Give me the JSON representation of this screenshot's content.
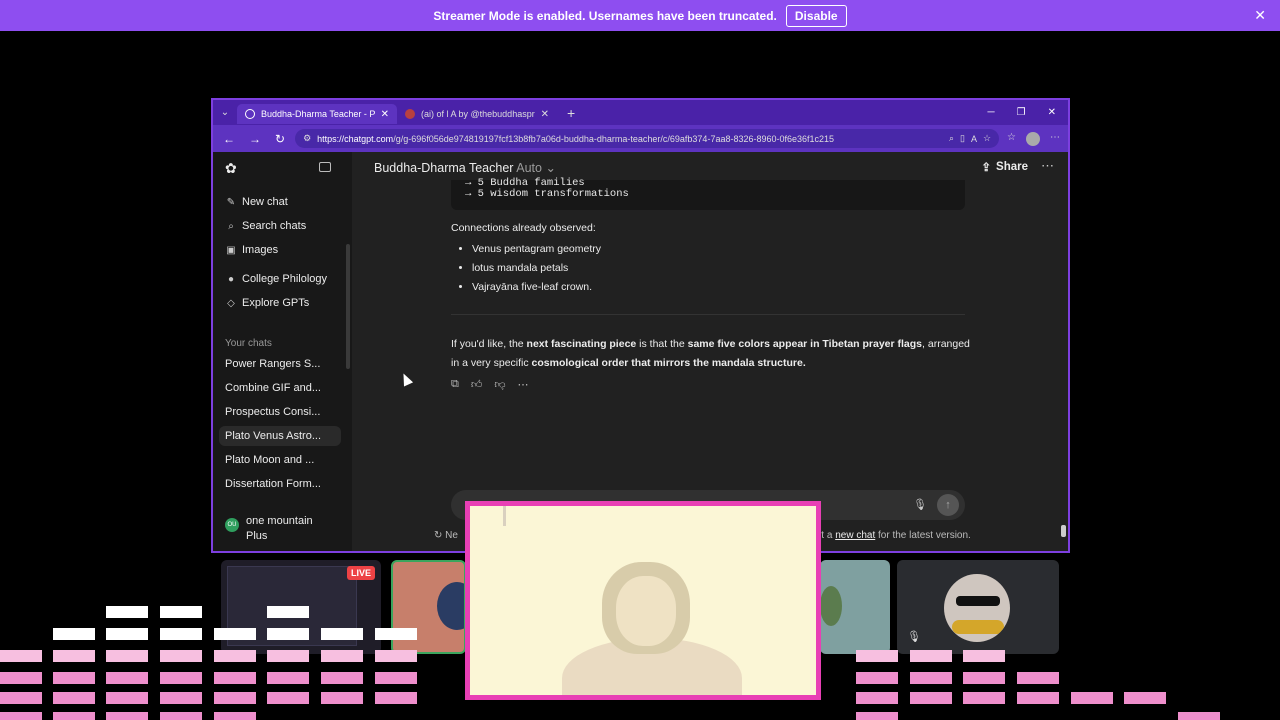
{
  "banner": {
    "message": "Streamer Mode is enabled. Usernames have been truncated.",
    "disable_label": "Disable",
    "close_icon": "✕"
  },
  "browser": {
    "tabs": [
      {
        "label": "Buddha-Dharma Teacher - Plato V",
        "active": true
      },
      {
        "label": "(ai) of l A by @thebuddhaspriest",
        "active": false
      }
    ],
    "new_tab": "+",
    "url_host": "https://chatgpt.com",
    "url_path": "/g/g-696f056de974819197fcf13b8fb7a06d-buddha-dharma-teacher/c/69afb374-7aa8-8326-8960-0f6e36f1c215"
  },
  "sidebar": {
    "top_items": [
      {
        "label": "New chat",
        "icon": "✎"
      },
      {
        "label": "Search chats",
        "icon": "⌕"
      },
      {
        "label": "Images",
        "icon": "▣"
      },
      {
        "label": "College Philology",
        "icon": "●"
      },
      {
        "label": "Explore GPTs",
        "icon": "◇"
      }
    ],
    "section": "Your chats",
    "chats": [
      "Power Rangers S...",
      "Combine GIF and...",
      "Prospectus Consi...",
      "Plato Venus Astro...",
      "Plato Moon and ...",
      "Dissertation Form..."
    ],
    "user": {
      "initials": "OU",
      "name_line1": "one mountain",
      "name_line2": "Plus"
    }
  },
  "chat": {
    "title": "Buddha-Dharma Teacher",
    "mode": "Auto",
    "share_label": "Share",
    "code_lines": [
      "→ 5 Buddha families",
      "→ 5 wisdom transformations"
    ],
    "connections_heading": "Connections already observed:",
    "bullets": [
      "Venus pentagram geometry",
      "lotus mandala petals",
      "Vajrayāna five-leaf crown."
    ],
    "closing_parts": [
      {
        "t": "If you'd like, the ",
        "b": false
      },
      {
        "t": "next fascinating piece",
        "b": true
      },
      {
        "t": " is that the ",
        "b": false
      },
      {
        "t": "same five colors appear in Tibetan prayer flags",
        "b": true
      },
      {
        "t": ", arranged in a very specific ",
        "b": false
      },
      {
        "t": "cosmological order that mirrors the mandala structure.",
        "b": true
      }
    ],
    "notice_left": "Ne",
    "notice_mid": "rt a ",
    "notice_link": "new chat",
    "notice_end": " for the latest version."
  },
  "stream": {
    "live_badge": "LIVE"
  },
  "colors": {
    "banner": "#8e4ef0",
    "window_border": "#7d3fe0",
    "cam_border": "#e83fb5",
    "eq_pink": "#f7bfe0"
  }
}
